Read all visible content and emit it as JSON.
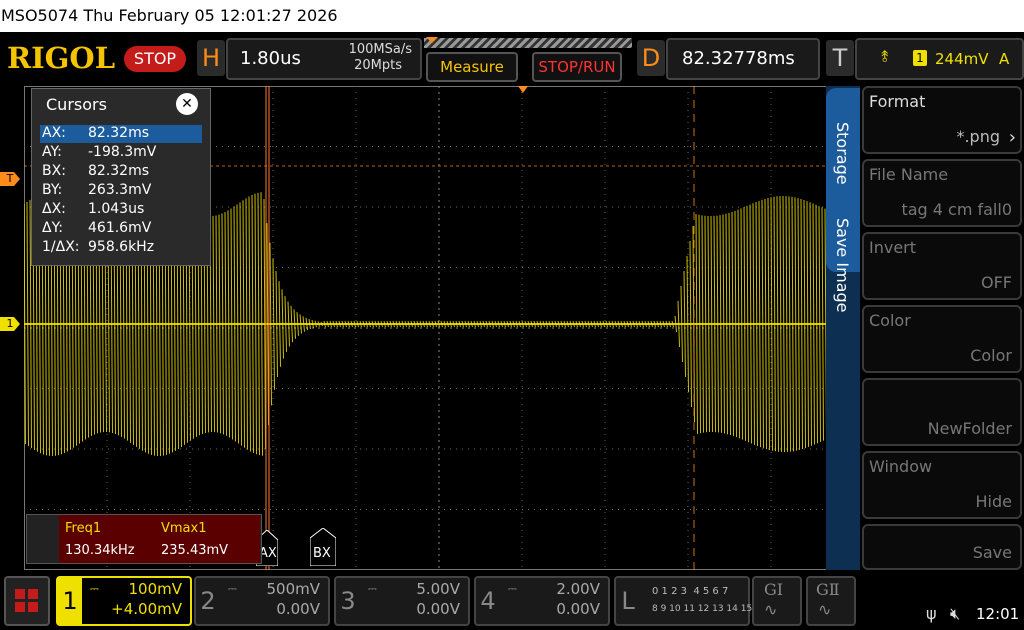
{
  "window": {
    "title": "MSO5074  Thu February 05 12:01:27 2026"
  },
  "header": {
    "brand": "RIGOL",
    "run_state": "STOP",
    "horizontal": {
      "letter": "H",
      "timebase": "1.80us",
      "sample_rate": "100MSa/s",
      "memory_depth": "20Mpts"
    },
    "measure_label": "Measure",
    "stop_run_label": "STOP/RUN",
    "delay": {
      "letter": "D",
      "value": "82.32778ms"
    },
    "trigger": {
      "letter": "T",
      "channel": "1",
      "level": "244mV",
      "mode": "A"
    }
  },
  "cursors": {
    "title": "Cursors",
    "rows": [
      {
        "key": "AX:",
        "value": "82.32ms"
      },
      {
        "key": "AY:",
        "value": "-198.3mV"
      },
      {
        "key": "BX:",
        "value": "82.32ms"
      },
      {
        "key": "BY:",
        "value": "263.3mV"
      },
      {
        "key": "ΔX:",
        "value": "1.043us"
      },
      {
        "key": "ΔY:",
        "value": "461.6mV"
      },
      {
        "key": "1/ΔX:",
        "value": "958.6kHz"
      }
    ],
    "marker_a": "AX",
    "marker_b": "BX"
  },
  "measurements": [
    {
      "name": "Freq1",
      "value": "130.34kHz"
    },
    {
      "name": "Vmax1",
      "value": "235.43mV"
    }
  ],
  "markers": {
    "trigger_marker": "T",
    "channel_marker": "1"
  },
  "side_menu": {
    "tabs": [
      "Storage",
      "Save Image"
    ],
    "buttons": [
      {
        "title": "Format",
        "value": "*.png",
        "enabled": true
      },
      {
        "title": "File Name",
        "value": "tag 4 cm fall0",
        "enabled": false
      },
      {
        "title": "Invert",
        "value": "OFF",
        "enabled": false
      },
      {
        "title": "Color",
        "value": "Color",
        "enabled": false
      },
      {
        "title": "",
        "value": "NewFolder",
        "enabled": false
      },
      {
        "title": "Window",
        "value": "Hide",
        "enabled": false
      },
      {
        "title": "",
        "value": "Save",
        "enabled": false
      }
    ]
  },
  "channels": [
    {
      "num": "1",
      "scale": "100mV",
      "offset": "+4.00mV",
      "active": true,
      "color": "#f0e000"
    },
    {
      "num": "2",
      "scale": "500mV",
      "offset": "0.00V",
      "active": false,
      "color": "#00e0e0"
    },
    {
      "num": "3",
      "scale": "5.00V",
      "offset": "0.00V",
      "active": false,
      "color": "#ff40ff"
    },
    {
      "num": "4",
      "scale": "2.00V",
      "offset": "0.00V",
      "active": false,
      "color": "#3a7cff"
    }
  ],
  "logic": {
    "letter": "L",
    "row1": "0 1 2 3  4 5 6 7",
    "row2": "8 9 10 11 12 13 14 15"
  },
  "generators": [
    "GⅠ",
    "GⅡ"
  ],
  "status": {
    "time": "12:01"
  },
  "colors": {
    "ch1": "#f0e000",
    "cursor_a": "#ff7733",
    "cursor_b": "#ff7733",
    "accent": "#1d5c9c",
    "brand": "#f5c400"
  }
}
